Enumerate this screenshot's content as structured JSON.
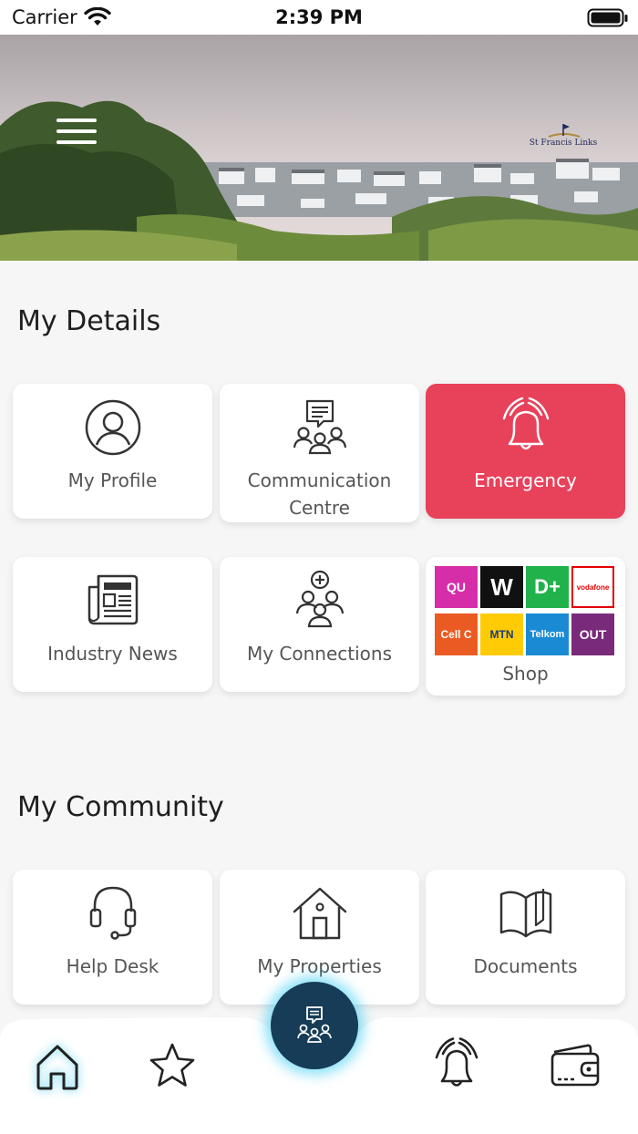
{
  "status_bar": {
    "carrier": "Carrier",
    "time": "2:39 PM"
  },
  "header": {
    "logo_text": "St Francis Links",
    "menu_icon": "hamburger-menu-icon"
  },
  "my_details": {
    "title": "My Details",
    "tiles": [
      {
        "label": "My Profile",
        "icon": "user-circle-icon"
      },
      {
        "label": "Communication Centre",
        "icon": "group-chat-icon"
      },
      {
        "label": "Emergency",
        "icon": "alarm-bell-icon",
        "color": "#e8415a"
      },
      {
        "label": "Industry News",
        "icon": "newspaper-icon"
      },
      {
        "label": "My Connections",
        "icon": "add-group-icon"
      },
      {
        "label": "Shop",
        "icon": "brand-logos-grid"
      }
    ],
    "shop_brands": [
      "QU",
      "W",
      "D+",
      "vodafone",
      "Cell C",
      "MTN",
      "Telkom",
      "OUT"
    ]
  },
  "my_community": {
    "title": "My Community",
    "tiles": [
      {
        "label": "Help Desk",
        "icon": "headset-icon"
      },
      {
        "label": "My Properties",
        "icon": "house-icon"
      },
      {
        "label": "Documents",
        "icon": "open-book-icon"
      }
    ]
  },
  "bottom_nav": {
    "items": [
      "home-icon",
      "star-icon",
      "community-fab-icon",
      "alarm-bell-icon",
      "wallet-icon"
    ],
    "accent": "#173c57",
    "glow": "#28c8f0"
  }
}
